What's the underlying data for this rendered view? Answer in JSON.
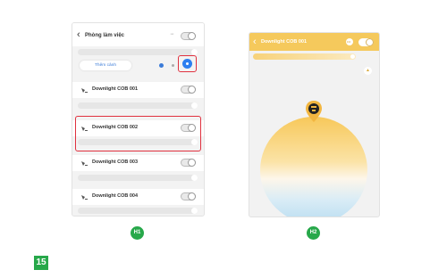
{
  "h1": {
    "header_title": "Phòng làm việc",
    "menu_dots": "···",
    "scene_button_label": "Thêm cảnh",
    "devices": [
      {
        "name": "Downlight COB 001",
        "on": false,
        "highlighted": false
      },
      {
        "name": "Downlight COB 002",
        "on": false,
        "highlighted": true
      },
      {
        "name": "Downlight COB 003",
        "on": false,
        "highlighted": false
      },
      {
        "name": "Downlight COB 004",
        "on": false,
        "highlighted": false
      }
    ],
    "label": "H1"
  },
  "h2": {
    "header_title": "Downlight COB 001",
    "power_on": true,
    "label": "H2"
  },
  "step_number": "15",
  "colors": {
    "accent_green": "#27a84a",
    "highlight_red": "#e0313f",
    "warm_yellow": "#f5c95c",
    "link_blue": "#3b7bd8"
  }
}
